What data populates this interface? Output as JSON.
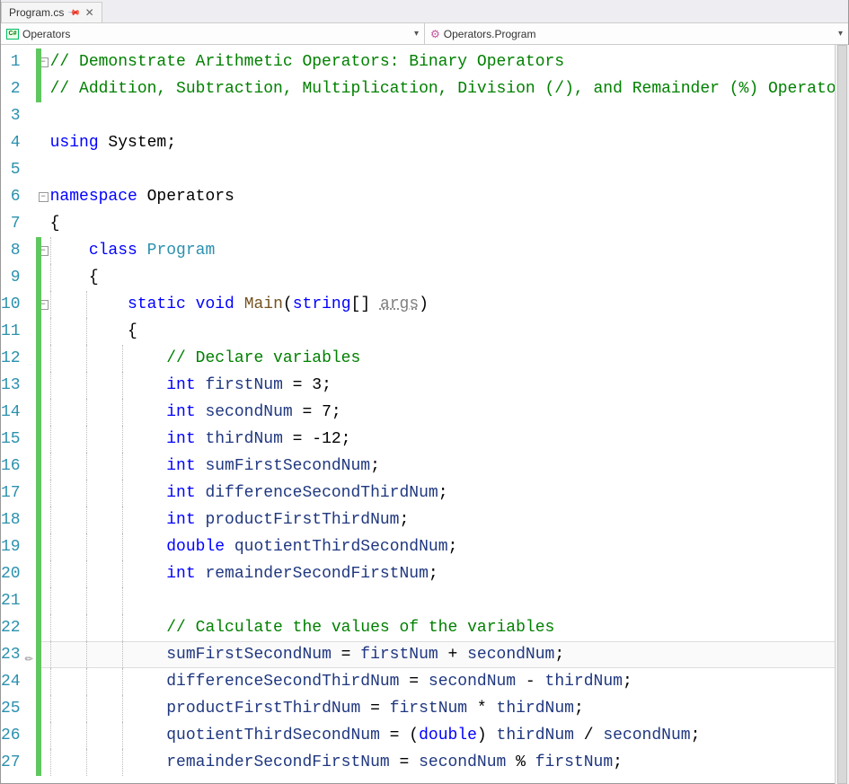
{
  "tab": {
    "label": "Program.cs"
  },
  "nav": {
    "namespace": "Operators",
    "class": "Operators.Program"
  },
  "lines": [
    {
      "n": 1,
      "fold": "box",
      "bar": true,
      "tokens": [
        [
          "c-comment",
          "// Demonstrate Arithmetic Operators: Binary Operators"
        ]
      ]
    },
    {
      "n": 2,
      "bar": true,
      "tokens": [
        [
          "c-comment",
          "// Addition, Subtraction, Multiplication, Division (/), and Remainder (%) Operators"
        ]
      ]
    },
    {
      "n": 3,
      "tokens": []
    },
    {
      "n": 4,
      "tokens": [
        [
          "c-kw",
          "using"
        ],
        [
          "",
          " System;"
        ]
      ]
    },
    {
      "n": 5,
      "tokens": []
    },
    {
      "n": 6,
      "fold": "box",
      "tokens": [
        [
          "c-kw",
          "namespace"
        ],
        [
          "",
          " Operators"
        ]
      ]
    },
    {
      "n": 7,
      "tokens": [
        [
          "",
          "{"
        ]
      ]
    },
    {
      "n": 8,
      "fold": "box",
      "bar": true,
      "indent": 1,
      "tokens": [
        [
          "c-kw",
          "class"
        ],
        [
          "",
          " "
        ],
        [
          "c-type",
          "Program"
        ]
      ]
    },
    {
      "n": 9,
      "bar": true,
      "indent": 1,
      "tokens": [
        [
          "",
          "{"
        ]
      ]
    },
    {
      "n": 10,
      "fold": "box",
      "bar": true,
      "indent": 2,
      "tokens": [
        [
          "c-kw",
          "static"
        ],
        [
          "",
          " "
        ],
        [
          "c-kw",
          "void"
        ],
        [
          "",
          " "
        ],
        [
          "c-method",
          "Main"
        ],
        [
          "",
          "("
        ],
        [
          "c-kw",
          "string"
        ],
        [
          "",
          "[] "
        ],
        [
          "c-param",
          "args"
        ],
        [
          "",
          ")"
        ]
      ]
    },
    {
      "n": 11,
      "bar": true,
      "indent": 2,
      "tokens": [
        [
          "",
          "{"
        ]
      ]
    },
    {
      "n": 12,
      "bar": true,
      "indent": 3,
      "tokens": [
        [
          "c-comment",
          "// Declare variables"
        ]
      ]
    },
    {
      "n": 13,
      "bar": true,
      "indent": 3,
      "tokens": [
        [
          "c-kw",
          "int"
        ],
        [
          "",
          " "
        ],
        [
          "c-local",
          "firstNum"
        ],
        [
          "",
          " = 3;"
        ]
      ]
    },
    {
      "n": 14,
      "bar": true,
      "indent": 3,
      "tokens": [
        [
          "c-kw",
          "int"
        ],
        [
          "",
          " "
        ],
        [
          "c-local",
          "secondNum"
        ],
        [
          "",
          " = 7;"
        ]
      ]
    },
    {
      "n": 15,
      "bar": true,
      "indent": 3,
      "tokens": [
        [
          "c-kw",
          "int"
        ],
        [
          "",
          " "
        ],
        [
          "c-local",
          "thirdNum"
        ],
        [
          "",
          " = -12;"
        ]
      ]
    },
    {
      "n": 16,
      "bar": true,
      "indent": 3,
      "tokens": [
        [
          "c-kw",
          "int"
        ],
        [
          "",
          " "
        ],
        [
          "c-local",
          "sumFirstSecondNum"
        ],
        [
          "",
          ";"
        ]
      ]
    },
    {
      "n": 17,
      "bar": true,
      "indent": 3,
      "tokens": [
        [
          "c-kw",
          "int"
        ],
        [
          "",
          " "
        ],
        [
          "c-local",
          "differenceSecondThirdNum"
        ],
        [
          "",
          ";"
        ]
      ]
    },
    {
      "n": 18,
      "bar": true,
      "indent": 3,
      "tokens": [
        [
          "c-kw",
          "int"
        ],
        [
          "",
          " "
        ],
        [
          "c-local",
          "productFirstThirdNum"
        ],
        [
          "",
          ";"
        ]
      ]
    },
    {
      "n": 19,
      "bar": true,
      "indent": 3,
      "tokens": [
        [
          "c-kw",
          "double"
        ],
        [
          "",
          " "
        ],
        [
          "c-local",
          "quotientThirdSecondNum"
        ],
        [
          "",
          ";"
        ]
      ]
    },
    {
      "n": 20,
      "bar": true,
      "indent": 3,
      "tokens": [
        [
          "c-kw",
          "int"
        ],
        [
          "",
          " "
        ],
        [
          "c-local",
          "remainderSecondFirstNum"
        ],
        [
          "",
          ";"
        ]
      ]
    },
    {
      "n": 21,
      "bar": true,
      "indent": 3,
      "tokens": []
    },
    {
      "n": 22,
      "bar": true,
      "indent": 3,
      "tokens": [
        [
          "c-comment",
          "// Calculate the values of the variables"
        ]
      ]
    },
    {
      "n": 23,
      "bar": true,
      "pencil": true,
      "highlight": true,
      "indent": 3,
      "tokens": [
        [
          "c-local",
          "sumFirstSecondNum"
        ],
        [
          "",
          " = "
        ],
        [
          "c-local",
          "firstNum"
        ],
        [
          "",
          " + "
        ],
        [
          "c-local",
          "secondNum"
        ],
        [
          "",
          ";"
        ]
      ]
    },
    {
      "n": 24,
      "bar": true,
      "indent": 3,
      "tokens": [
        [
          "c-local",
          "differenceSecondThirdNum"
        ],
        [
          "",
          " = "
        ],
        [
          "c-local",
          "secondNum"
        ],
        [
          "",
          " - "
        ],
        [
          "c-local",
          "thirdNum"
        ],
        [
          "",
          ";"
        ]
      ]
    },
    {
      "n": 25,
      "bar": true,
      "indent": 3,
      "tokens": [
        [
          "c-local",
          "productFirstThirdNum"
        ],
        [
          "",
          " = "
        ],
        [
          "c-local",
          "firstNum"
        ],
        [
          "",
          " * "
        ],
        [
          "c-local",
          "thirdNum"
        ],
        [
          "",
          ";"
        ]
      ]
    },
    {
      "n": 26,
      "bar": true,
      "indent": 3,
      "tokens": [
        [
          "c-local",
          "quotientThirdSecondNum"
        ],
        [
          "",
          " = ("
        ],
        [
          "c-kw",
          "double"
        ],
        [
          "",
          ") "
        ],
        [
          "c-local",
          "thirdNum"
        ],
        [
          "",
          " / "
        ],
        [
          "c-local",
          "secondNum"
        ],
        [
          "",
          ";"
        ]
      ]
    },
    {
      "n": 27,
      "bar": true,
      "indent": 3,
      "tokens": [
        [
          "c-local",
          "remainderSecondFirstNum"
        ],
        [
          "",
          " = "
        ],
        [
          "c-local",
          "secondNum"
        ],
        [
          "",
          " % "
        ],
        [
          "c-local",
          "firstNum"
        ],
        [
          "",
          ";"
        ]
      ]
    }
  ]
}
